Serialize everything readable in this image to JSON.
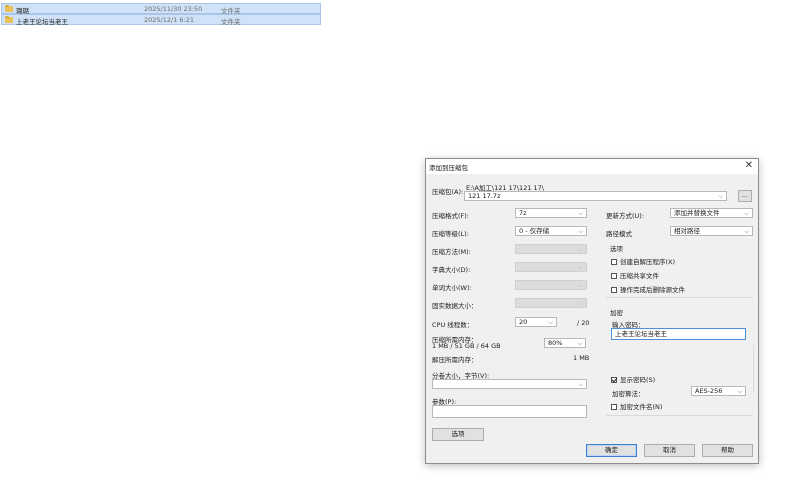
{
  "files": [
    {
      "name": "璐璐",
      "date": "2025/11/30 23:50",
      "type": "文件夹"
    },
    {
      "name": "上老王论坛当老王",
      "date": "2025/12/1 6:21",
      "type": "文件夹"
    }
  ],
  "dialog": {
    "title": "添加到压缩包",
    "archive_label": "压缩包(A):",
    "archive_path": "E:\\A加工\\121 17\\121 17\\",
    "archive_name": "121 17.7z",
    "browse_label": "...",
    "format_label": "压缩格式(F):",
    "format_value": "7z",
    "level_label": "压缩等级(L):",
    "level_value": "0 - 仅存储",
    "method_label": "压缩方法(M):",
    "dict_label": "字典大小(D):",
    "word_label": "单词大小(W):",
    "solid_label": "固实数据大小：",
    "cpu_label": "CPU 线程数：",
    "cpu_value": "20",
    "cpu_total": "/ 20",
    "mem_label": "压缩所需内存：",
    "mem_detail": "1 MB / 51 GB / 64 GB",
    "mem_percent": "80%",
    "demem_label": "解压所需内存：",
    "demem_value": "1 MB",
    "split_label": "分卷大小，字节(V):",
    "params_label": "参数(P):",
    "options_button": "选项",
    "update_label": "更新方式(U):",
    "update_value": "添加并替换文件",
    "pathmode_label": "路径模式",
    "pathmode_value": "相对路径",
    "options_group": "选项",
    "opt_sfx": "创建自解压程序(X)",
    "opt_shared": "压缩共享文件",
    "opt_delete": "操作完成后删除源文件",
    "encrypt_group": "加密",
    "password_label": "输入密码：",
    "password_value": "上老王论坛当老王",
    "show_password": "显示密码(S)",
    "enc_method_label": "加密算法：",
    "enc_method_value": "AES-256",
    "enc_names": "加密文件名(N)",
    "ok_button": "确定",
    "cancel_button": "取消",
    "help_button": "帮助"
  },
  "colors": {
    "selection_bg": "#cfe2f7",
    "folder_icon": "#e9c25a",
    "default_button_border": "#3c7fd1"
  }
}
